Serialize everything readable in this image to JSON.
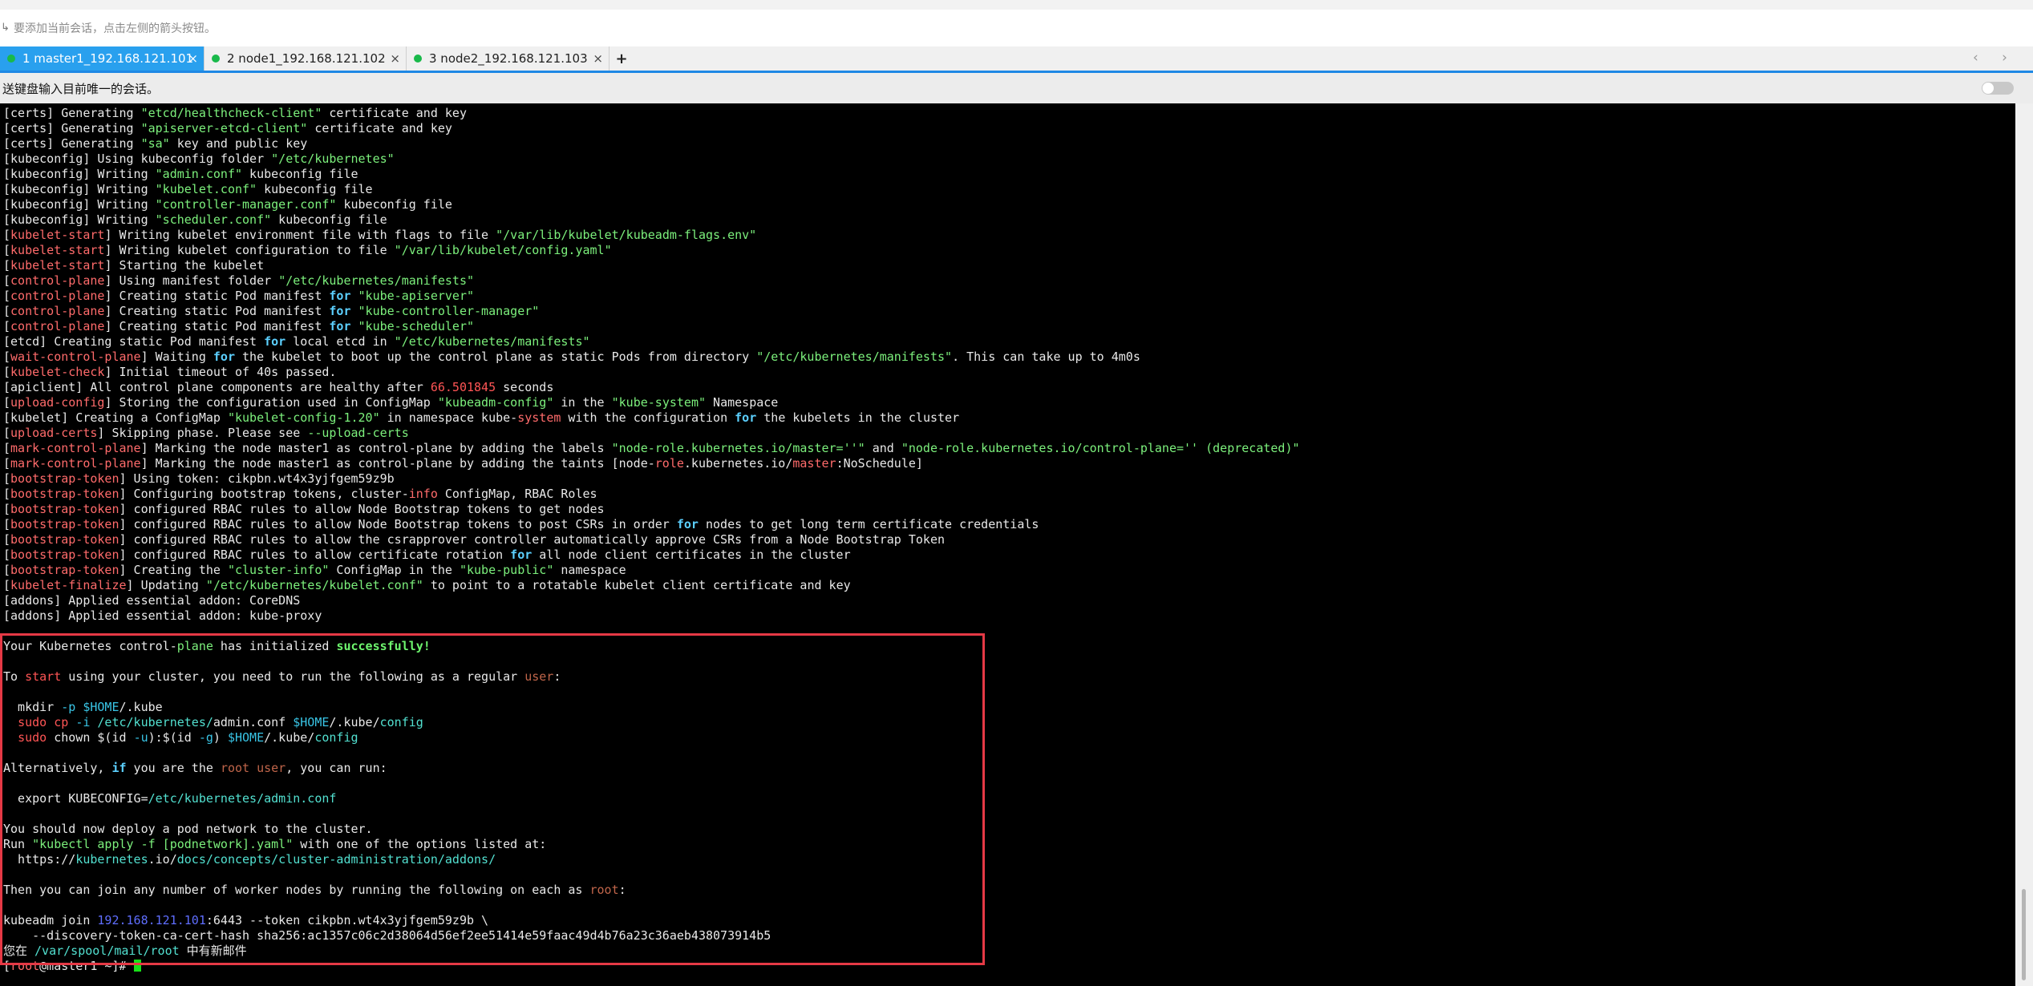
{
  "hint": {
    "text": "要添加当前会话，点击左侧的箭头按钮。",
    "icon": "session-add-arrow-icon"
  },
  "tabs": [
    {
      "label": "1 master1_192.168.121.101",
      "active": true,
      "status": "connected"
    },
    {
      "label": "2 node1_192.168.121.102",
      "active": false,
      "status": "connected"
    },
    {
      "label": "3 node2_192.168.121.103",
      "active": false,
      "status": "connected"
    }
  ],
  "tab_controls": {
    "add": "+",
    "close": "×",
    "nav": "‹ ›"
  },
  "sendbar": {
    "label": "送键盘输入目前唯一的会话。",
    "toggle_on": false
  },
  "colors": {
    "accent": "#1e88e5",
    "active_tab": "#29a0ee",
    "status_dot": "#19b94a",
    "highlight_border": "#e53945"
  },
  "terminal": {
    "log_lines": [
      [
        [
          "[certs] Generating ",
          ""
        ],
        [
          "\"etcd/healthcheck-client\"",
          "str"
        ],
        [
          " certificate and key",
          ""
        ]
      ],
      [
        [
          "[certs] Generating ",
          ""
        ],
        [
          "\"apiserver-etcd-client\"",
          "str"
        ],
        [
          " certificate and key",
          ""
        ]
      ],
      [
        [
          "[certs] Generating ",
          ""
        ],
        [
          "\"sa\"",
          "str"
        ],
        [
          " key and public key",
          ""
        ]
      ],
      [
        [
          "[kubeconfig] Using kubeconfig folder ",
          ""
        ],
        [
          "\"/etc/kubernetes\"",
          "str"
        ]
      ],
      [
        [
          "[kubeconfig] Writing ",
          ""
        ],
        [
          "\"admin.conf\"",
          "str"
        ],
        [
          " kubeconfig file",
          ""
        ]
      ],
      [
        [
          "[kubeconfig] Writing ",
          ""
        ],
        [
          "\"kubelet.conf\"",
          "str"
        ],
        [
          " kubeconfig file",
          ""
        ]
      ],
      [
        [
          "[kubeconfig] Writing ",
          ""
        ],
        [
          "\"controller-manager.conf\"",
          "str"
        ],
        [
          " kubeconfig file",
          ""
        ]
      ],
      [
        [
          "[kubeconfig] Writing ",
          ""
        ],
        [
          "\"scheduler.conf\"",
          "str"
        ],
        [
          " kubeconfig file",
          ""
        ]
      ],
      [
        [
          "[",
          ""
        ],
        [
          "kubelet-start",
          "tag-red"
        ],
        [
          "] Writing kubelet environment file with flags to file ",
          ""
        ],
        [
          "\"/var/lib/kubelet/kubeadm-flags.env\"",
          "str"
        ]
      ],
      [
        [
          "[",
          ""
        ],
        [
          "kubelet-start",
          "tag-red"
        ],
        [
          "] Writing kubelet configuration to file ",
          ""
        ],
        [
          "\"/var/lib/kubelet/config.yaml\"",
          "str"
        ]
      ],
      [
        [
          "[",
          ""
        ],
        [
          "kubelet-start",
          "tag-red"
        ],
        [
          "] Starting the kubelet",
          ""
        ]
      ],
      [
        [
          "[",
          ""
        ],
        [
          "control-plane",
          "tag-red"
        ],
        [
          "] Using manifest folder ",
          ""
        ],
        [
          "\"/etc/kubernetes/manifests\"",
          "str"
        ]
      ],
      [
        [
          "[",
          ""
        ],
        [
          "control-plane",
          "tag-red"
        ],
        [
          "] Creating static Pod manifest ",
          ""
        ],
        [
          "for",
          "kw"
        ],
        [
          " ",
          ""
        ],
        [
          "\"kube-apiserver\"",
          "str"
        ]
      ],
      [
        [
          "[",
          ""
        ],
        [
          "control-plane",
          "tag-red"
        ],
        [
          "] Creating static Pod manifest ",
          ""
        ],
        [
          "for",
          "kw"
        ],
        [
          " ",
          ""
        ],
        [
          "\"kube-controller-manager\"",
          "str"
        ]
      ],
      [
        [
          "[",
          ""
        ],
        [
          "control-plane",
          "tag-red"
        ],
        [
          "] Creating static Pod manifest ",
          ""
        ],
        [
          "for",
          "kw"
        ],
        [
          " ",
          ""
        ],
        [
          "\"kube-scheduler\"",
          "str"
        ]
      ],
      [
        [
          "[etcd] Creating static Pod manifest ",
          ""
        ],
        [
          "for",
          "kw"
        ],
        [
          " local etcd in ",
          ""
        ],
        [
          "\"/etc/kubernetes/manifests\"",
          "str"
        ]
      ],
      [
        [
          "[",
          ""
        ],
        [
          "wait-control-plane",
          "tag-red"
        ],
        [
          "] Waiting ",
          ""
        ],
        [
          "for",
          "kw"
        ],
        [
          " the kubelet to boot up the control plane as static Pods from directory ",
          ""
        ],
        [
          "\"/etc/kubernetes/manifests\"",
          "str"
        ],
        [
          ". This can take up to 4m0s",
          ""
        ]
      ],
      [
        [
          "[",
          ""
        ],
        [
          "kubelet-check",
          "tag-red"
        ],
        [
          "] Initial timeout of 40s passed.",
          ""
        ]
      ],
      [
        [
          "[apiclient] All control plane components are healthy after ",
          ""
        ],
        [
          "66.501845",
          "num"
        ],
        [
          " seconds",
          ""
        ]
      ],
      [
        [
          "[",
          ""
        ],
        [
          "upload-config",
          "tag-red"
        ],
        [
          "] Storing the configuration used in ConfigMap ",
          ""
        ],
        [
          "\"kubeadm-config\"",
          "str"
        ],
        [
          " in the ",
          ""
        ],
        [
          "\"kube-system\"",
          "str"
        ],
        [
          " Namespace",
          ""
        ]
      ],
      [
        [
          "[kubelet] Creating a ConfigMap ",
          ""
        ],
        [
          "\"kubelet-config-1.20\"",
          "str"
        ],
        [
          " in namespace kube-",
          ""
        ],
        [
          "system",
          "tag-red"
        ],
        [
          " with the configuration ",
          ""
        ],
        [
          "for",
          "kw"
        ],
        [
          " the kubelets in the cluster",
          ""
        ]
      ],
      [
        [
          "[",
          ""
        ],
        [
          "upload-certs",
          "tag-red"
        ],
        [
          "] Skipping phase. Please see ",
          ""
        ],
        [
          "--upload-certs",
          "str"
        ]
      ],
      [
        [
          "[",
          ""
        ],
        [
          "mark-control-plane",
          "tag-red"
        ],
        [
          "] Marking the node master1 as control-plane by adding the labels ",
          ""
        ],
        [
          "\"node-role.kubernetes.io/master=''\"",
          "str"
        ],
        [
          " and ",
          ""
        ],
        [
          "\"node-role.kubernetes.io/control-plane='' (deprecated)\"",
          "str"
        ]
      ],
      [
        [
          "[",
          ""
        ],
        [
          "mark-control-plane",
          "tag-red"
        ],
        [
          "] Marking the node master1 as control-plane by adding the taints [node-",
          ""
        ],
        [
          "role",
          "tag-red"
        ],
        [
          ".kubernetes.io/",
          ""
        ],
        [
          "master",
          "tag-red"
        ],
        [
          ":NoSchedule]",
          ""
        ]
      ],
      [
        [
          "[",
          ""
        ],
        [
          "bootstrap-token",
          "tag-red"
        ],
        [
          "] Using token: cikpbn.wt4x3yjfgem59z9b",
          ""
        ]
      ],
      [
        [
          "[",
          ""
        ],
        [
          "bootstrap-token",
          "tag-red"
        ],
        [
          "] Configuring bootstrap tokens, cluster-",
          ""
        ],
        [
          "info",
          "tag-red"
        ],
        [
          " ConfigMap, RBAC Roles",
          ""
        ]
      ],
      [
        [
          "[",
          ""
        ],
        [
          "bootstrap-token",
          "tag-red"
        ],
        [
          "] configured RBAC rules to allow Node Bootstrap tokens to get nodes",
          ""
        ]
      ],
      [
        [
          "[",
          ""
        ],
        [
          "bootstrap-token",
          "tag-red"
        ],
        [
          "] configured RBAC rules to allow Node Bootstrap tokens to post CSRs in order ",
          ""
        ],
        [
          "for",
          "kw"
        ],
        [
          " nodes to get long term certificate credentials",
          ""
        ]
      ],
      [
        [
          "[",
          ""
        ],
        [
          "bootstrap-token",
          "tag-red"
        ],
        [
          "] configured RBAC rules to allow the csrapprover controller automatically approve CSRs from a Node Bootstrap Token",
          ""
        ]
      ],
      [
        [
          "[",
          ""
        ],
        [
          "bootstrap-token",
          "tag-red"
        ],
        [
          "] configured RBAC rules to allow certificate rotation ",
          ""
        ],
        [
          "for",
          "kw"
        ],
        [
          " all node client certificates in the cluster",
          ""
        ]
      ],
      [
        [
          "[",
          ""
        ],
        [
          "bootstrap-token",
          "tag-red"
        ],
        [
          "] Creating the ",
          ""
        ],
        [
          "\"cluster-info\"",
          "str"
        ],
        [
          " ConfigMap in the ",
          ""
        ],
        [
          "\"kube-public\"",
          "str"
        ],
        [
          " namespace",
          ""
        ]
      ],
      [
        [
          "[",
          ""
        ],
        [
          "kubelet-finalize",
          "tag-red"
        ],
        [
          "] Updating ",
          ""
        ],
        [
          "\"/etc/kubernetes/kubelet.conf\"",
          "str"
        ],
        [
          " to point to a rotatable kubelet client certificate and key",
          ""
        ]
      ],
      [
        [
          "[addons] Applied essential addon: CoreDNS",
          ""
        ]
      ],
      [
        [
          "[addons] Applied essential addon: kube-proxy",
          ""
        ]
      ]
    ],
    "result_lines": [
      [
        [
          "",
          ""
        ]
      ],
      [
        [
          "Your Kubernetes control-",
          ""
        ],
        [
          "plane",
          "str"
        ],
        [
          " has initialized ",
          ""
        ],
        [
          "successfully!",
          "succ"
        ]
      ],
      [
        [
          "",
          ""
        ]
      ],
      [
        [
          "To ",
          ""
        ],
        [
          "start",
          "cmd"
        ],
        [
          " using your cluster, you need to run the following as a regular ",
          ""
        ],
        [
          "user",
          "user"
        ],
        [
          ":",
          ""
        ]
      ],
      [
        [
          "",
          ""
        ]
      ],
      [
        [
          "  mkdir ",
          ""
        ],
        [
          "-p",
          "var"
        ],
        [
          " ",
          ""
        ],
        [
          "$HOME",
          "var"
        ],
        [
          "/.kube",
          ""
        ]
      ],
      [
        [
          "  ",
          ""
        ],
        [
          "sudo",
          "cmd"
        ],
        [
          " ",
          ""
        ],
        [
          "cp",
          "cmd"
        ],
        [
          " ",
          ""
        ],
        [
          "-i",
          "var"
        ],
        [
          " ",
          ""
        ],
        [
          "/etc/kubernetes/",
          "path"
        ],
        [
          "admin",
          ""
        ],
        [
          ".conf ",
          ""
        ],
        [
          "$HOME",
          "var"
        ],
        [
          "/.kube/",
          ""
        ],
        [
          "config",
          "path"
        ]
      ],
      [
        [
          "  ",
          ""
        ],
        [
          "sudo",
          "cmd"
        ],
        [
          " chown $(id ",
          ""
        ],
        [
          "-u",
          "var"
        ],
        [
          "):$(id ",
          ""
        ],
        [
          "-g",
          "var"
        ],
        [
          ") ",
          ""
        ],
        [
          "$HOME",
          "var"
        ],
        [
          "/.kube/",
          ""
        ],
        [
          "config",
          "path"
        ]
      ],
      [
        [
          "",
          ""
        ]
      ],
      [
        [
          "Alternatively, ",
          ""
        ],
        [
          "if",
          "kw"
        ],
        [
          " you are the ",
          ""
        ],
        [
          "root user",
          "user"
        ],
        [
          ", you can run:",
          ""
        ]
      ],
      [
        [
          "",
          ""
        ]
      ],
      [
        [
          "  export KUBECONFIG=",
          ""
        ],
        [
          "/etc/kubernetes/admin.conf",
          "path"
        ]
      ],
      [
        [
          "",
          ""
        ]
      ],
      [
        [
          "You should now deploy a pod network to the cluster.",
          ""
        ]
      ],
      [
        [
          "Run ",
          ""
        ],
        [
          "\"kubectl apply -f [podnetwork].yaml\"",
          "str"
        ],
        [
          " with one of the options listed at:",
          ""
        ]
      ],
      [
        [
          "  https://",
          ""
        ],
        [
          "kubernetes",
          "path"
        ],
        [
          ".io/",
          ""
        ],
        [
          "docs/concepts/cluster-administration/addons/",
          "path"
        ]
      ],
      [
        [
          "",
          ""
        ]
      ],
      [
        [
          "Then you can join any number of worker nodes by running the following on each as ",
          ""
        ],
        [
          "root",
          "user"
        ],
        [
          ":",
          ""
        ]
      ],
      [
        [
          "",
          ""
        ]
      ],
      [
        [
          "kubeadm join ",
          ""
        ],
        [
          "192.168.121.101",
          "blue"
        ],
        [
          ":6443 --token cikpbn.wt4x3yjfgem59z9b \\",
          ""
        ]
      ],
      [
        [
          "    --discovery-token-ca-cert-hash sha256:ac1357c06c2d38064d56ef2ee51414e59faac49d4b76a23c36aeb438073914b5",
          ""
        ]
      ],
      [
        [
          "您在 ",
          ""
        ],
        [
          "/var/spool/mail/root",
          "path"
        ],
        [
          " 中有新邮件",
          ""
        ]
      ]
    ],
    "prompt": [
      [
        "[",
        ""
      ],
      [
        "root",
        "tag-red"
      ],
      [
        "@master1 ~]# ",
        ""
      ]
    ]
  }
}
